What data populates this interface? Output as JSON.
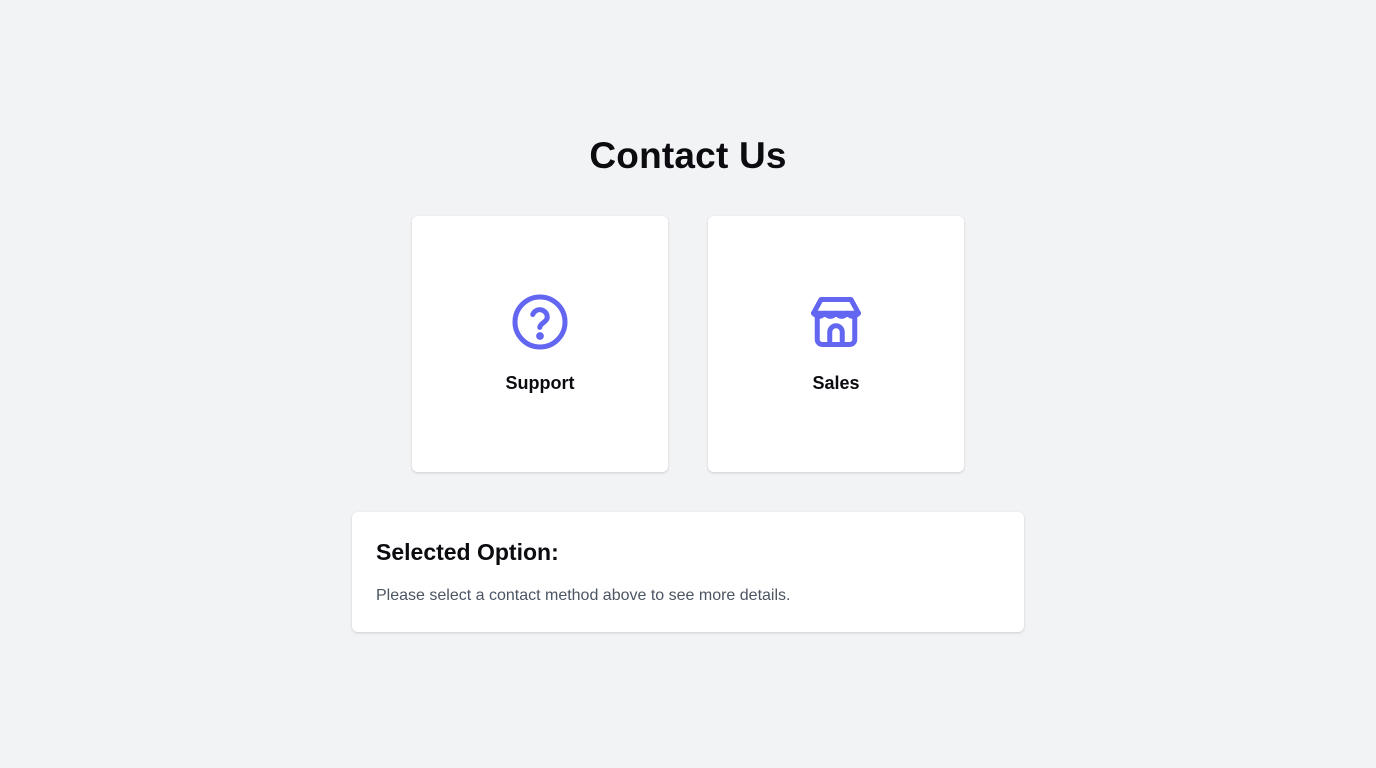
{
  "page": {
    "title": "Contact Us"
  },
  "options": [
    {
      "label": "Support",
      "icon": "question-circle-icon"
    },
    {
      "label": "Sales",
      "icon": "storefront-icon"
    }
  ],
  "details": {
    "title": "Selected Option:",
    "text": "Please select a contact method above to see more details."
  },
  "colors": {
    "accent": "#6366f1",
    "background": "#f2f3f5",
    "muted_text": "#4b5563"
  }
}
